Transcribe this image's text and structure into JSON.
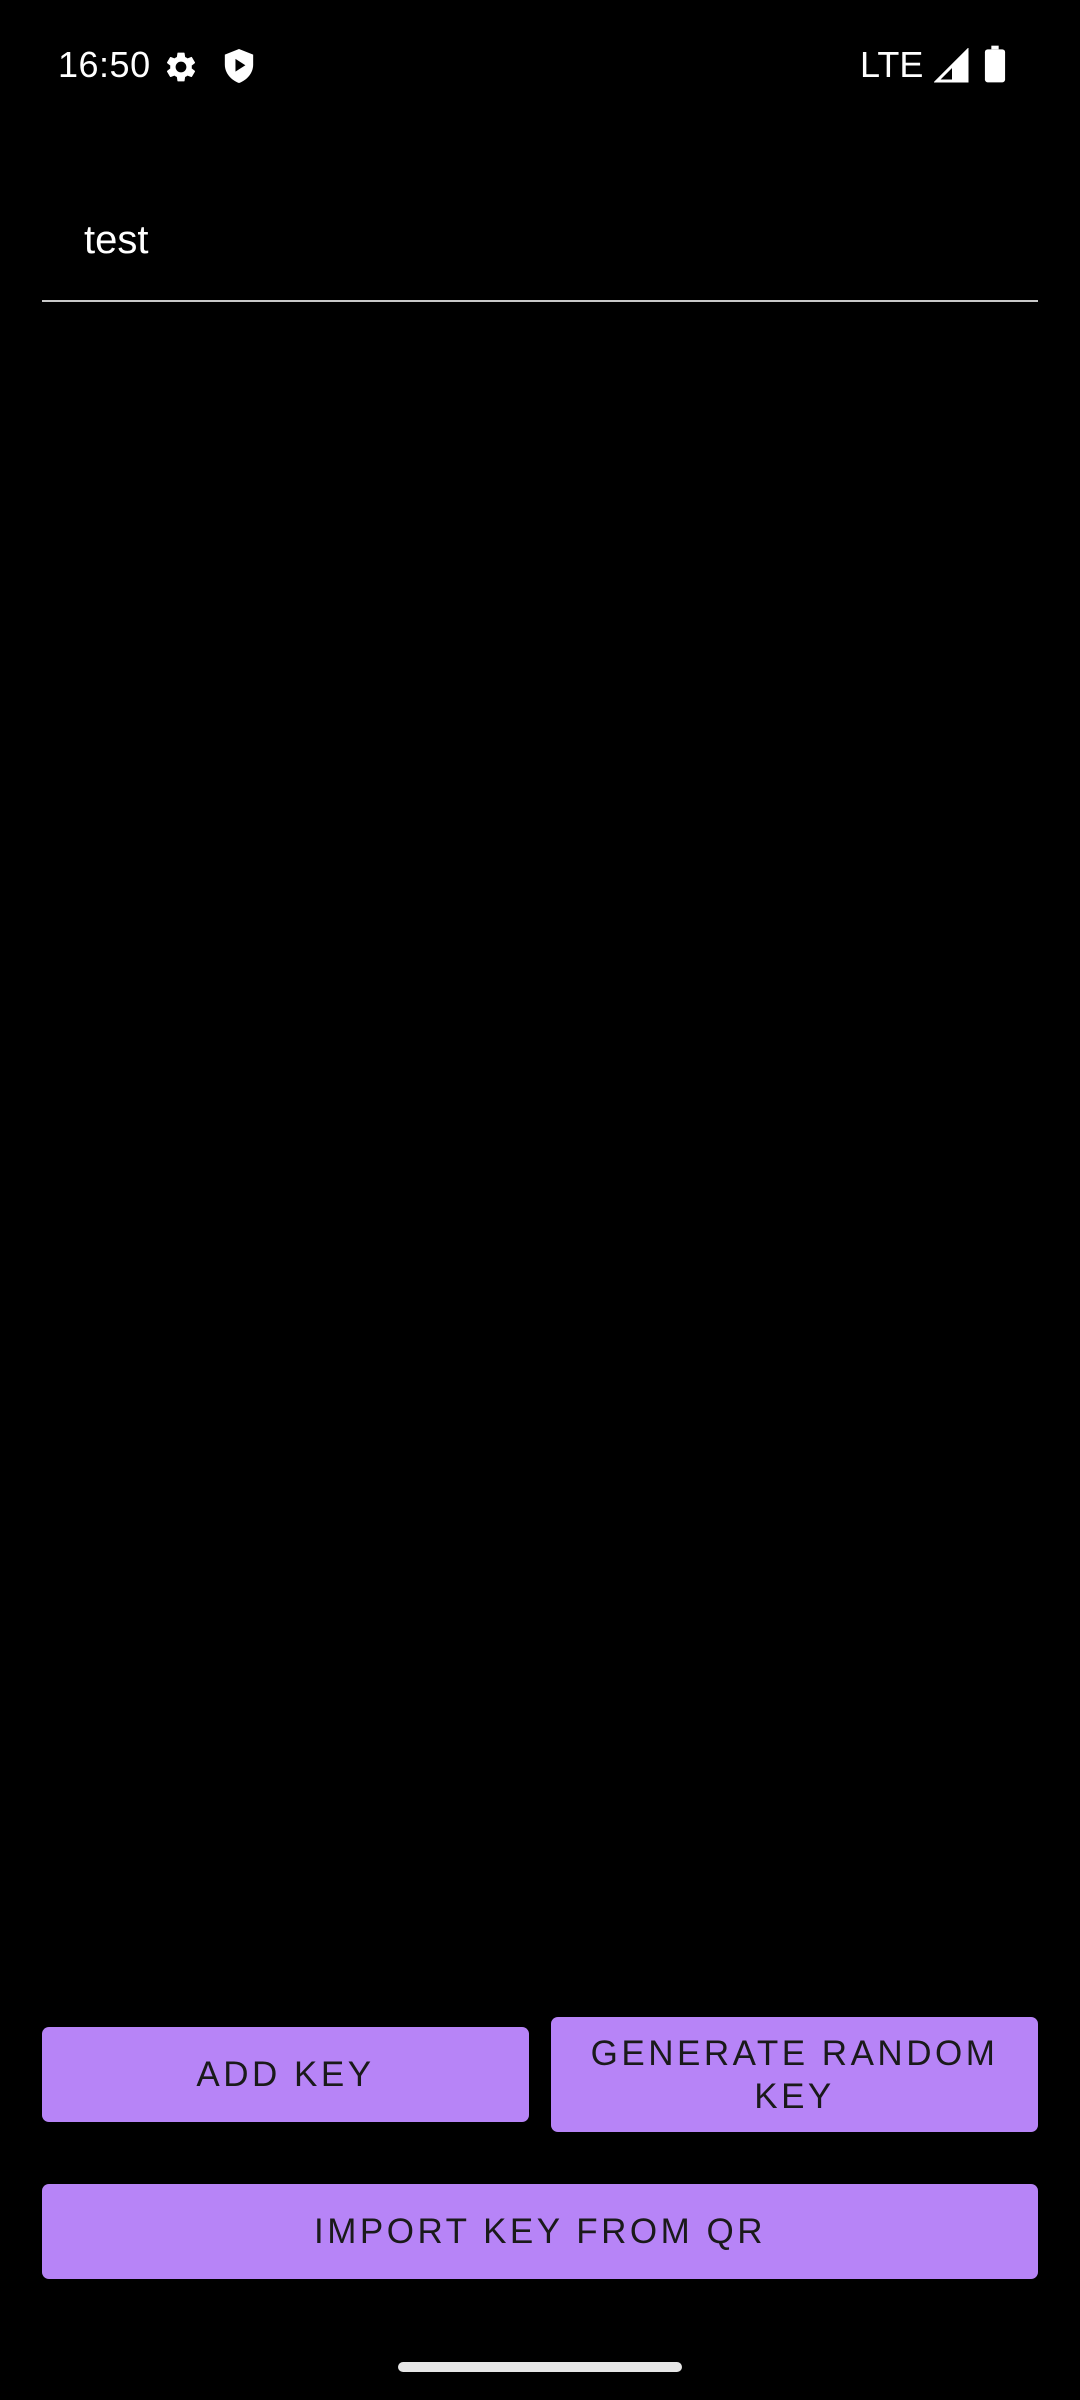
{
  "status_bar": {
    "time": "16:50",
    "network": "LTE",
    "icons": [
      "gear-icon",
      "shield-icon",
      "signal-icon",
      "battery-icon"
    ]
  },
  "form": {
    "key_name_value": "test"
  },
  "buttons": {
    "add_key": "ADD KEY",
    "generate_random_key": "GENERATE RANDOM KEY",
    "import_key_from_qr": "IMPORT KEY FROM QR"
  },
  "colors": {
    "background": "#000000",
    "button": "#b784f7",
    "button_text": "#1a1a1a",
    "underline": "#c9c9c9"
  }
}
